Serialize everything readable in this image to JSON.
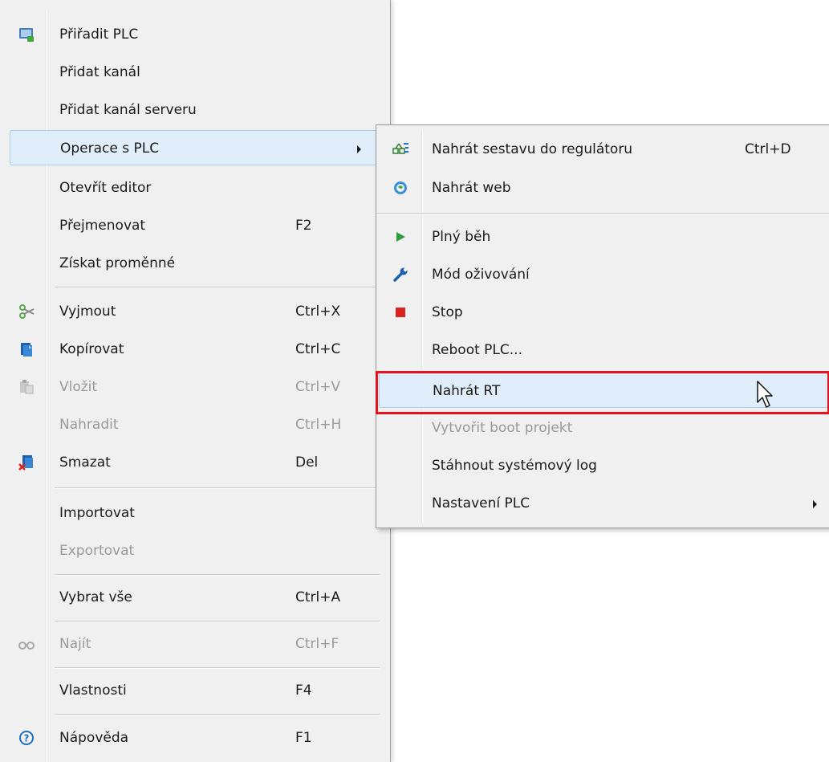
{
  "main_menu": {
    "items": [
      {
        "id": "assign-plc",
        "label": "Přiřadit PLC",
        "shortcut": "",
        "icon": "assign-plc-icon",
        "disabled": false
      },
      {
        "id": "add-channel",
        "label": "Přidat kanál",
        "shortcut": "",
        "icon": "",
        "disabled": false
      },
      {
        "id": "add-server-channel",
        "label": "Přidat kanál serveru",
        "shortcut": "",
        "icon": "",
        "disabled": false
      },
      {
        "id": "plc-operations",
        "label": "Operace s PLC",
        "shortcut": "",
        "icon": "",
        "disabled": false,
        "submenu": true,
        "active": true
      },
      {
        "id": "open-editor",
        "label": "Otevřít editor",
        "shortcut": "",
        "icon": "",
        "disabled": false
      },
      {
        "id": "rename",
        "label": "Přejmenovat",
        "shortcut": "F2",
        "icon": "",
        "disabled": false
      },
      {
        "id": "get-variables",
        "label": "Získat proměnné",
        "shortcut": "",
        "icon": "",
        "disabled": false
      },
      {
        "id": "cut",
        "label": "Vyjmout",
        "shortcut": "Ctrl+X",
        "icon": "scissors-icon",
        "disabled": false
      },
      {
        "id": "copy",
        "label": "Kopírovat",
        "shortcut": "Ctrl+C",
        "icon": "copy-icon",
        "disabled": false
      },
      {
        "id": "paste",
        "label": "Vložit",
        "shortcut": "Ctrl+V",
        "icon": "paste-icon",
        "disabled": true
      },
      {
        "id": "replace",
        "label": "Nahradit",
        "shortcut": "Ctrl+H",
        "icon": "",
        "disabled": true
      },
      {
        "id": "delete",
        "label": "Smazat",
        "shortcut": "Del",
        "icon": "delete-icon",
        "disabled": false
      },
      {
        "id": "import",
        "label": "Importovat",
        "shortcut": "",
        "icon": "",
        "disabled": false
      },
      {
        "id": "export",
        "label": "Exportovat",
        "shortcut": "",
        "icon": "",
        "disabled": true
      },
      {
        "id": "select-all",
        "label": "Vybrat vše",
        "shortcut": "Ctrl+A",
        "icon": "",
        "disabled": false
      },
      {
        "id": "find",
        "label": "Najít",
        "shortcut": "Ctrl+F",
        "icon": "binoculars-icon",
        "disabled": true
      },
      {
        "id": "properties",
        "label": "Vlastnosti",
        "shortcut": "F4",
        "icon": "",
        "disabled": false
      },
      {
        "id": "help",
        "label": "Nápověda",
        "shortcut": "F1",
        "icon": "help-icon",
        "disabled": false
      }
    ]
  },
  "submenu": {
    "items": [
      {
        "id": "upload-config",
        "label": "Nahrát sestavu do regulátoru",
        "shortcut": "Ctrl+D",
        "icon": "upload-config-icon",
        "disabled": false
      },
      {
        "id": "upload-web",
        "label": "Nahrát web",
        "shortcut": "",
        "icon": "globe-icon",
        "disabled": false
      },
      {
        "id": "full-run",
        "label": "Plný běh",
        "shortcut": "",
        "icon": "play-icon",
        "disabled": false
      },
      {
        "id": "commissioning-mode",
        "label": "Mód oživování",
        "shortcut": "",
        "icon": "wrench-icon",
        "disabled": false
      },
      {
        "id": "stop",
        "label": "Stop",
        "shortcut": "",
        "icon": "stop-icon",
        "disabled": false
      },
      {
        "id": "reboot-plc",
        "label": "Reboot PLC...",
        "shortcut": "",
        "icon": "",
        "disabled": false
      },
      {
        "id": "upload-rt",
        "label": "Nahrát RT",
        "shortcut": "",
        "icon": "",
        "disabled": false,
        "hover": true
      },
      {
        "id": "create-boot-project",
        "label": "Vytvořit boot projekt",
        "shortcut": "",
        "icon": "",
        "disabled": true
      },
      {
        "id": "download-system-log",
        "label": "Stáhnout systémový log",
        "shortcut": "",
        "icon": "",
        "disabled": false
      },
      {
        "id": "plc-settings",
        "label": "Nastavení PLC",
        "shortcut": "",
        "icon": "",
        "disabled": false,
        "submenu": true
      }
    ]
  },
  "colors": {
    "menu_background": "#f0f0f0",
    "hover_background": "#dfeefa",
    "hover_border": "#a8cfef",
    "disabled_text": "#9a9a9a",
    "highlight_annotation": "#e8111b"
  }
}
